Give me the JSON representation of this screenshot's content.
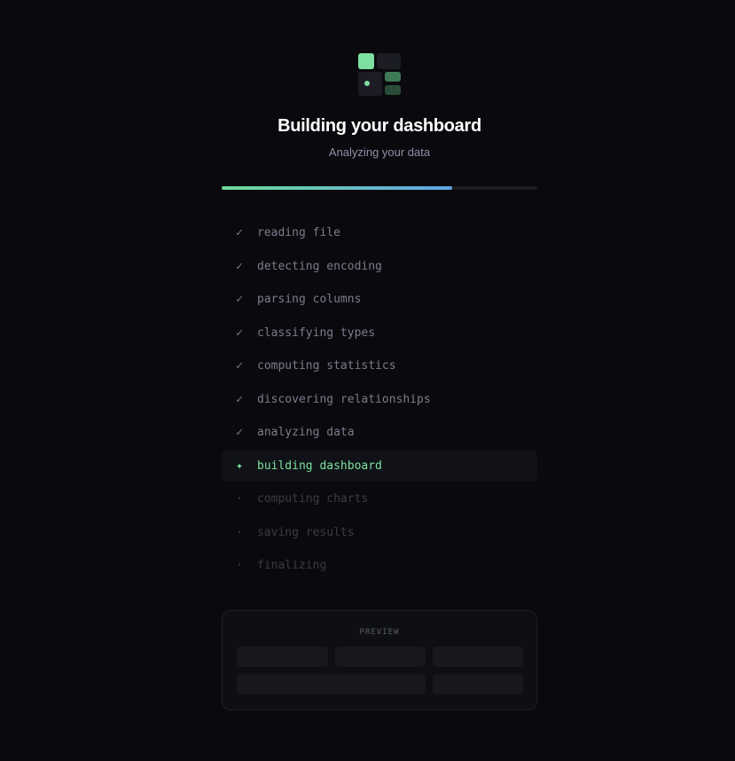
{
  "theme": {
    "accent": "#7ee0a0",
    "progress_gradient": [
      "#6fdb98",
      "#5fa6e8"
    ]
  },
  "header": {
    "logo_icon": "dashboard-grid-icon",
    "title": "Building your dashboard",
    "subtitle": "Analyzing your data"
  },
  "progress": {
    "fraction": 0.73
  },
  "steps": [
    {
      "label": "reading file",
      "status": "done",
      "mark": "✓"
    },
    {
      "label": "detecting encoding",
      "status": "done",
      "mark": "✓"
    },
    {
      "label": "parsing columns",
      "status": "done",
      "mark": "✓"
    },
    {
      "label": "classifying types",
      "status": "done",
      "mark": "✓"
    },
    {
      "label": "computing statistics",
      "status": "done",
      "mark": "✓"
    },
    {
      "label": "discovering relationships",
      "status": "done",
      "mark": "✓"
    },
    {
      "label": "analyzing data",
      "status": "done",
      "mark": "✓"
    },
    {
      "label": "building dashboard",
      "status": "active",
      "mark": "✦"
    },
    {
      "label": "computing charts",
      "status": "pending",
      "mark": "·"
    },
    {
      "label": "saving results",
      "status": "pending",
      "mark": "·"
    },
    {
      "label": "finalizing",
      "status": "pending",
      "mark": "·"
    }
  ],
  "preview": {
    "label": "PREVIEW"
  }
}
